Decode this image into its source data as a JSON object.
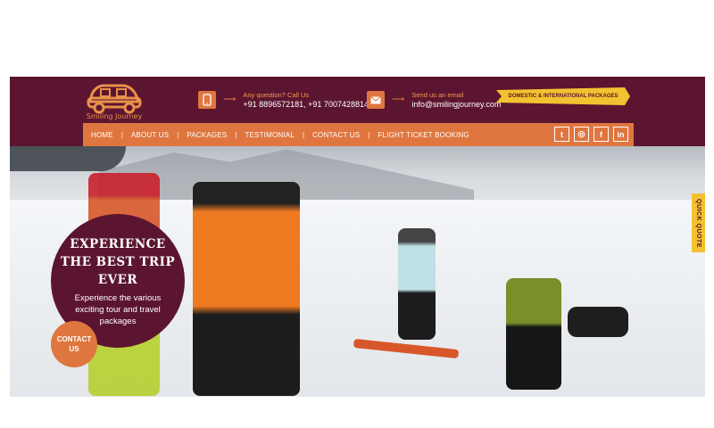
{
  "brand": {
    "name": "Smiling Journey",
    "color_primary": "#5c1530",
    "color_accent": "#e0763f",
    "color_ribbon": "#f2c230"
  },
  "contact_phone": {
    "label": "Any question? Call Us",
    "value": "+91 8896572181, +91 7007428814",
    "icon": "phone-icon"
  },
  "contact_email": {
    "label": "Send us an email",
    "value": "info@smilingjourney.com",
    "icon": "mail-icon"
  },
  "ribbon": {
    "text": "DOMESTIC & INTERNATIONAL PACKAGES"
  },
  "nav": {
    "items": [
      "HOME",
      "ABOUT US",
      "PACKAGES",
      "TESTIMONIAL",
      "CONTACT US",
      "FLIGHT TICKET BOOKING"
    ]
  },
  "social": {
    "icons": [
      "twitter-icon",
      "instagram-icon",
      "facebook-icon",
      "linkedin-icon"
    ],
    "labels": [
      "t",
      "◎",
      "f",
      "in"
    ]
  },
  "hero": {
    "heading_line1": "EXPERIENCE",
    "heading_line2": "THE BEST TRIP",
    "heading_line3": "EVER",
    "subtext": "Experience the various exciting tour and travel packages",
    "contact_button_line1": "CONTACT",
    "contact_button_line2": "US"
  },
  "quick_quote": {
    "label": "QUICK QUOTE"
  }
}
